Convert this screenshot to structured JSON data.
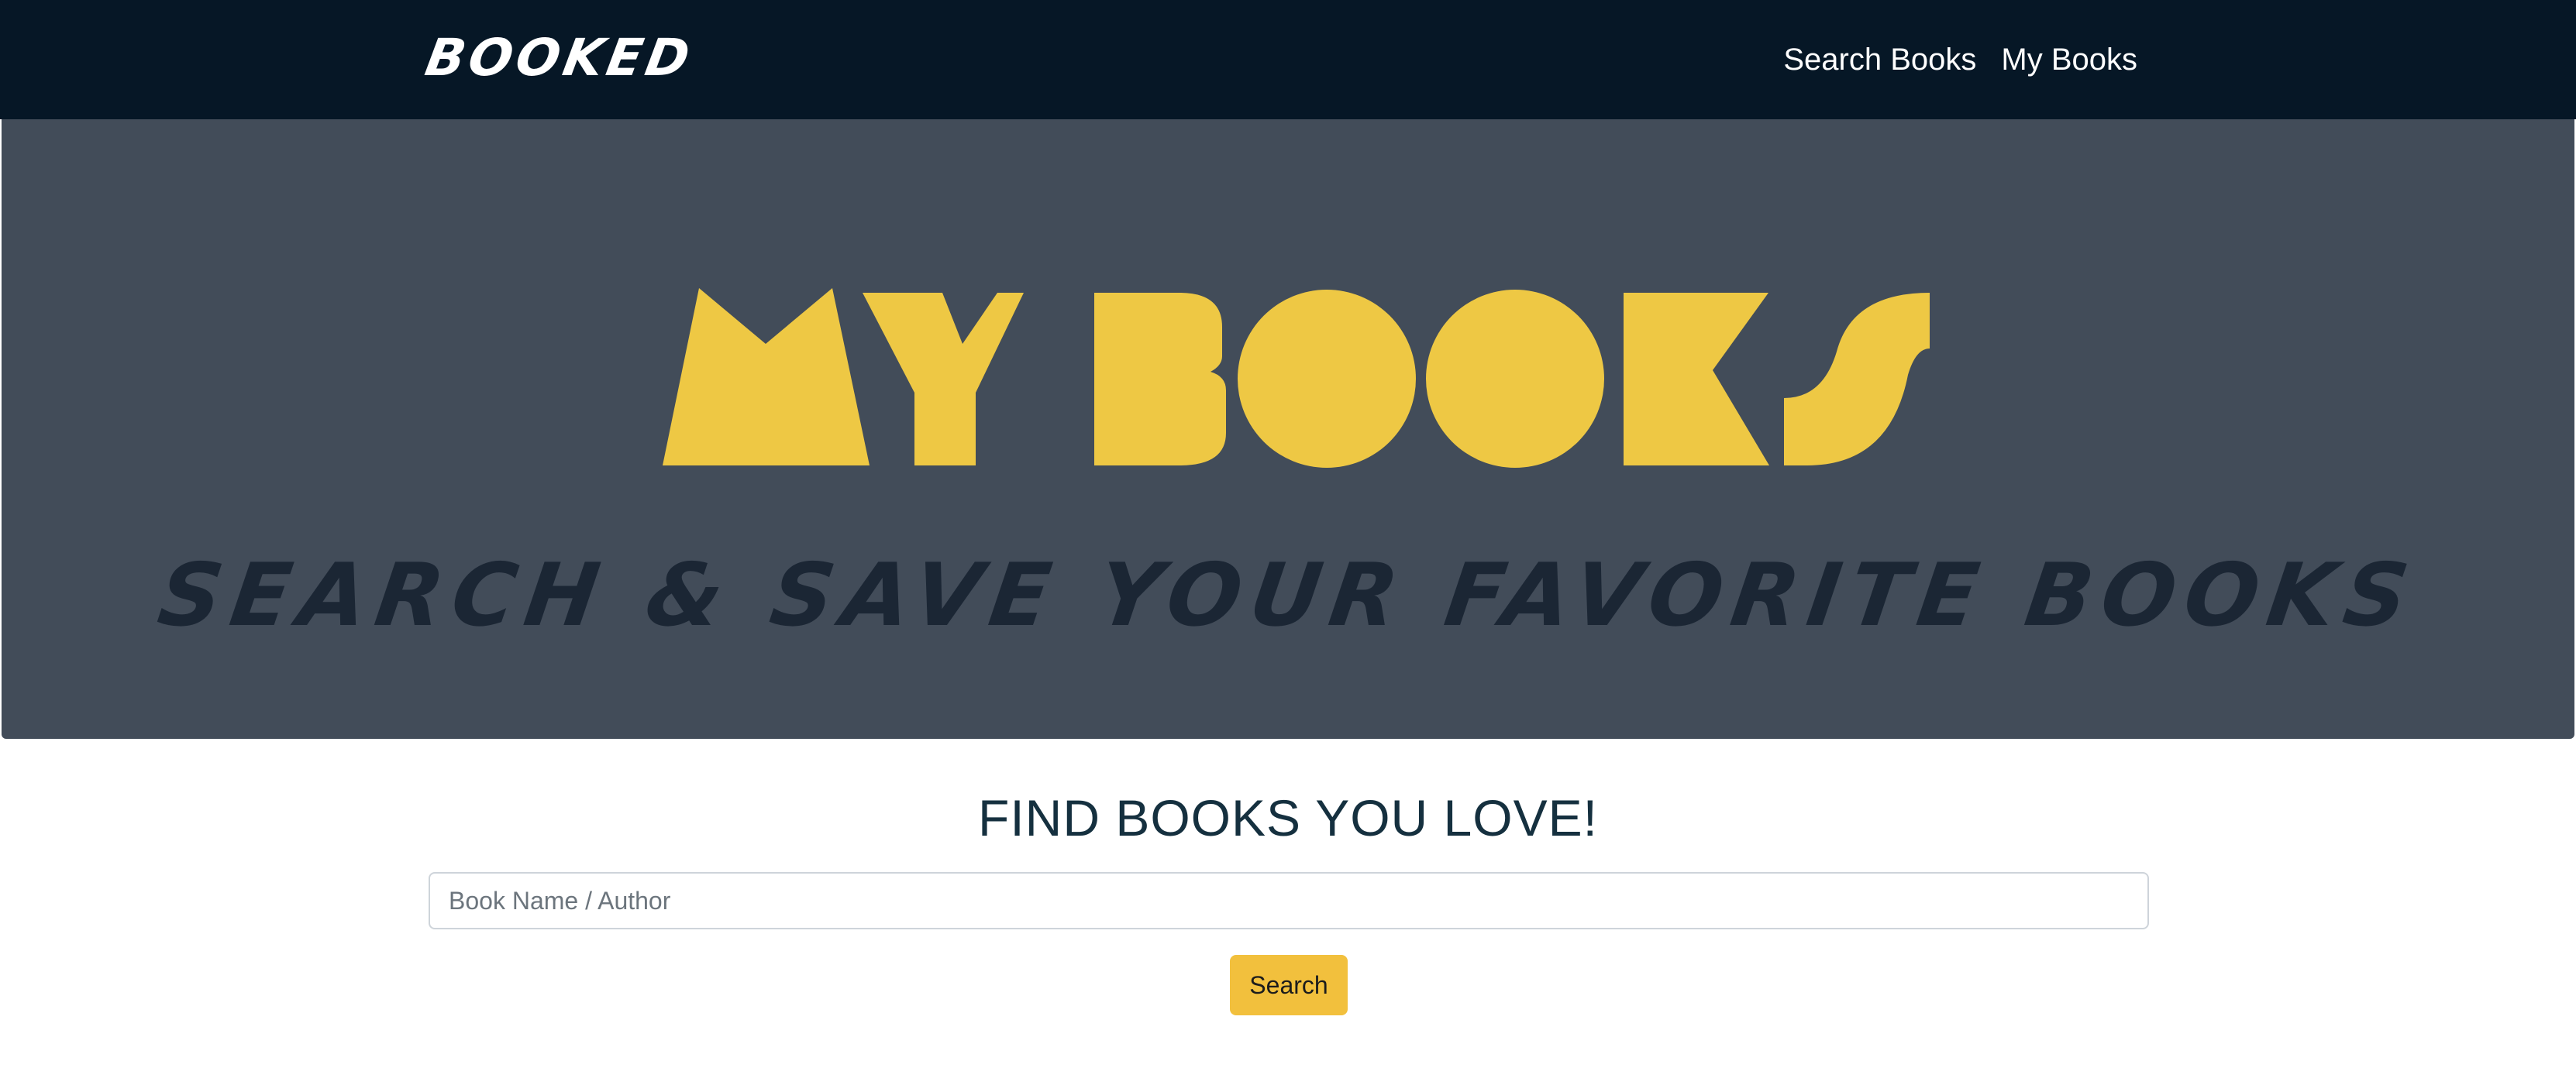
{
  "navbar": {
    "brand": "BOOKED",
    "links": [
      "Search Books",
      "My Books"
    ]
  },
  "hero": {
    "title": "MY BOOKS",
    "tagline": "SEARCH & SAVE YOUR FAVORITE BOOKS"
  },
  "search": {
    "heading": "FIND BOOKS YOU LOVE!",
    "placeholder": "Book Name / Author",
    "value": "",
    "button_label": "Search"
  },
  "colors": {
    "navbar_bg": "#061726",
    "hero_bg": "#424c59",
    "accent_yellow": "#eec844",
    "button_yellow": "#f2c03d",
    "tagline_dark": "#1b2634"
  }
}
